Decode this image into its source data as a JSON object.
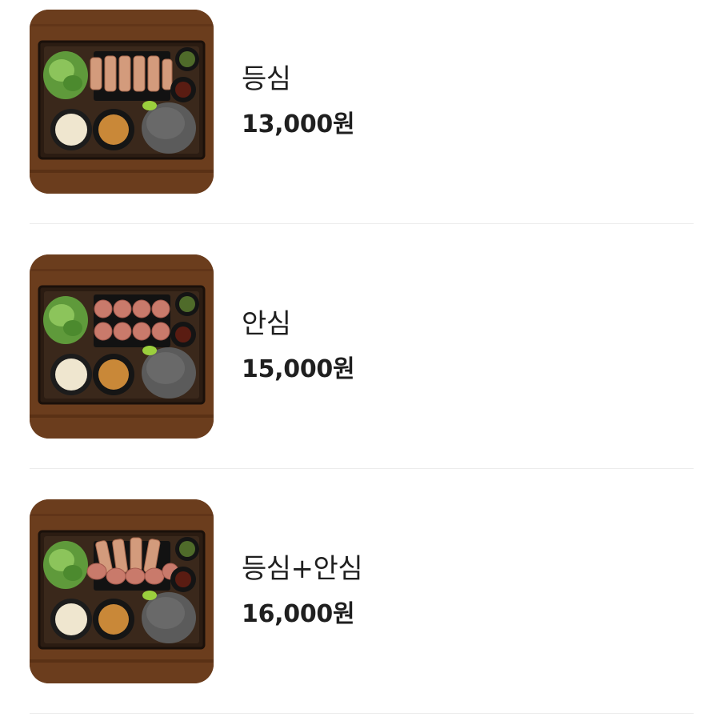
{
  "menu": {
    "items": [
      {
        "name": "등심",
        "price": "13,000원",
        "meat": "loin-cutlets"
      },
      {
        "name": "안심",
        "price": "15,000원",
        "meat": "tenderloin-pieces"
      },
      {
        "name": "등심+안심",
        "price": "16,000원",
        "meat": "mixed-cutlets"
      }
    ]
  }
}
